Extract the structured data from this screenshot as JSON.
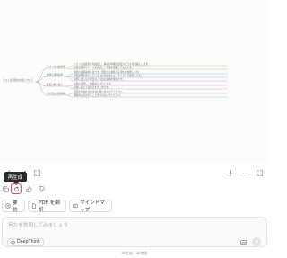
{
  "mindmap": {
    "root": "テストの質問の内容について",
    "branches": [
      {
        "label": "テストの前提条件",
        "leaves": [
          "テストの前提条件を確認し、事前の準備が必要かどうかを明確にします。",
          "必要な資料やツールを用意し、手順を把握しておきます。"
        ]
      },
      {
        "label": "質問の評価基準",
        "leaves": [
          "質問の評価基準に基づき、回答の正確性と妥当性を判断します。",
          "評価基準を満たしているかどうかをチェックリストで確認します。",
          "基準に達しない場合は、追加の説明を求めます。"
        ]
      },
      {
        "label": "結果の取り扱い",
        "leaves": [
          "結果は記録し、関係者に共有します。",
          "必要に応じて改善点をまとめます。"
        ]
      },
      {
        "label": "その他の注意事項",
        "leaves": [
          "不明点があれば担当者に問い合わせてください。",
          "期限内に提出することを忘れないでください。"
        ]
      }
    ]
  },
  "tooltip": "再生成",
  "chips": {
    "summary": "要約",
    "translate_pdf": "PDF を翻訳",
    "mindmap": "マインドマップ"
  },
  "composer": {
    "placeholder": "何かを質問してみましょう",
    "deepthink": "DeepThink"
  },
  "footer": "AI生成、参考用",
  "icons": {
    "back": "arrow-left-icon",
    "new_chat": "new-chat-icon",
    "fit": "fit-screen-icon",
    "zoom_in": "plus-icon",
    "zoom_out": "minus-icon",
    "fullscreen": "expand-icon",
    "copy": "copy-icon",
    "regenerate": "refresh-icon",
    "like": "thumb-up-icon",
    "dislike": "thumb-down-icon"
  },
  "colors": {
    "accent": "#e05050",
    "branch_1": "#c8a86a",
    "branch_2": "#7aa7c8",
    "branch_3": "#d98a8a",
    "branch_4": "#9ab88a"
  }
}
